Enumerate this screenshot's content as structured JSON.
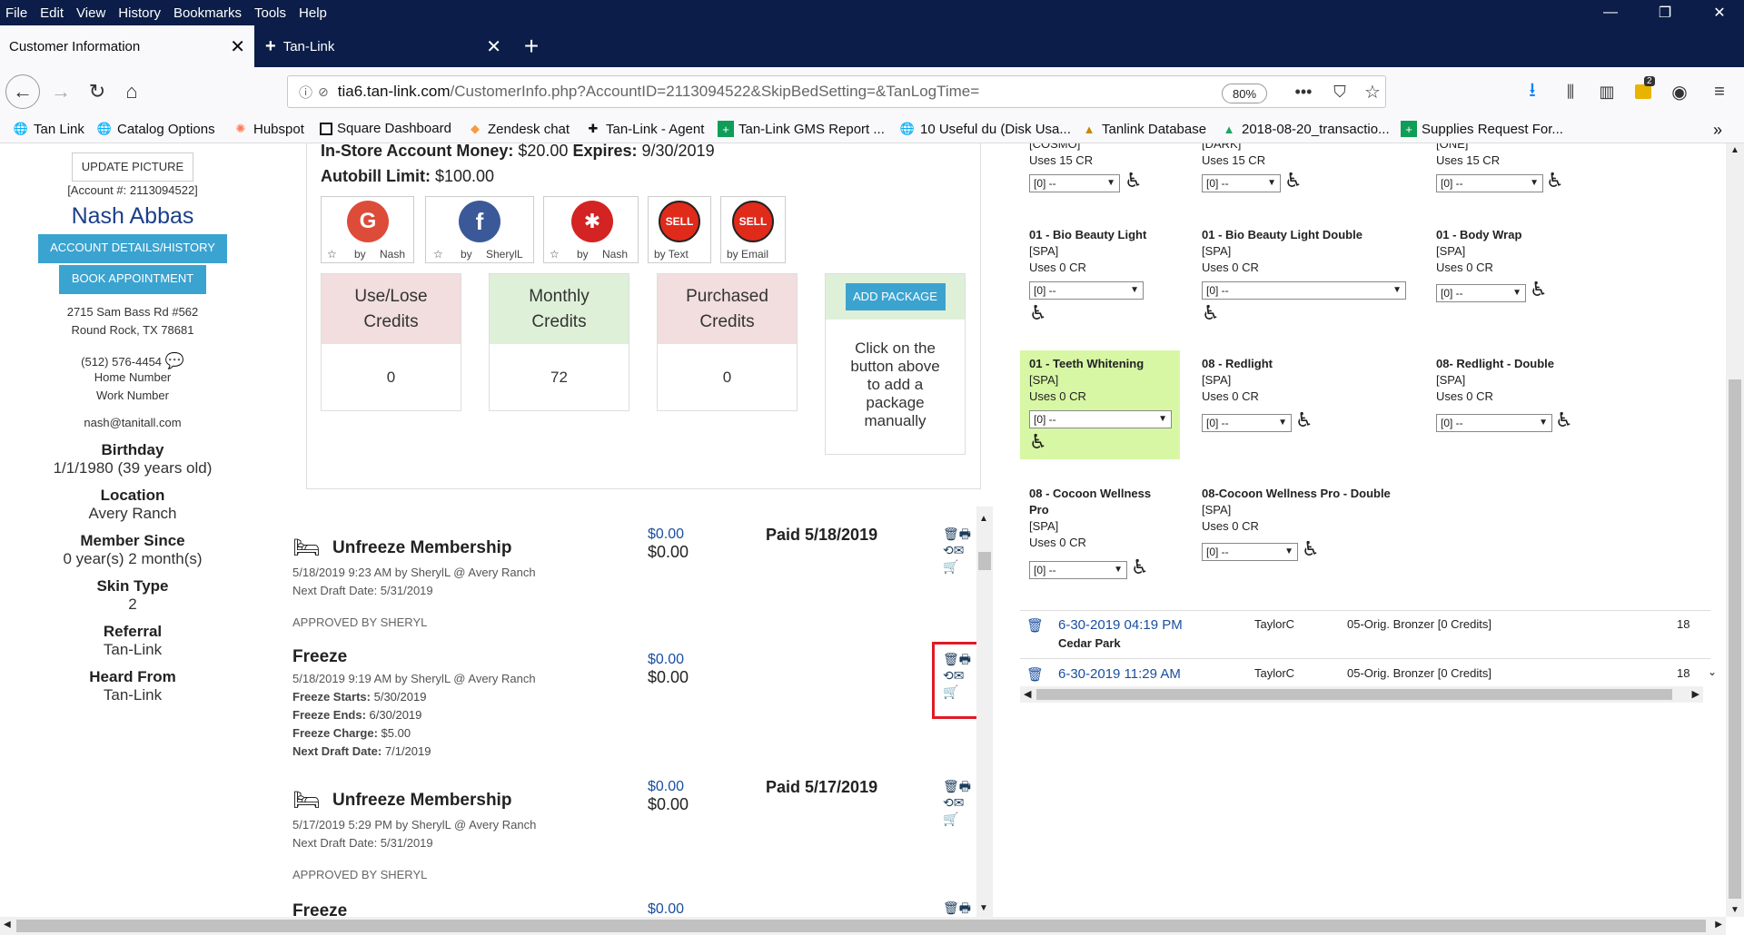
{
  "menu": [
    "File",
    "Edit",
    "View",
    "History",
    "Bookmarks",
    "Tools",
    "Help"
  ],
  "tabs": [
    {
      "label": "Customer Information"
    },
    {
      "label": "Tan-Link"
    }
  ],
  "url": {
    "host": "tia6.tan-link.com",
    "path": "/CustomerInfo.php?AccountID=2113094522&SkipBedSetting=&TanLogTime=",
    "zoom": "80%"
  },
  "toolbar": {
    "ext_badge": "2"
  },
  "bookmarks": [
    "Tan Link",
    "Catalog Options",
    "Hubspot",
    "Square Dashboard",
    "Zendesk chat",
    "Tan-Link - Agent",
    "Tan-Link GMS Report ...",
    "10 Useful du (Disk Usa...",
    "Tanlink Database",
    "2018-08-20_transactio...",
    "Supplies Request For..."
  ],
  "profile": {
    "update_picture": "UPDATE PICTURE",
    "account": "[Account #: 2113094522]",
    "name": "Nash Abbas",
    "details_btn": "ACCOUNT DETAILS/HISTORY",
    "book_btn": "BOOK APPOINTMENT",
    "addr1": "2715 Sam Bass Rd #562",
    "addr2": "Round Rock, TX 78681",
    "phone": "(512) 576-4454",
    "home": "Home Number",
    "work": "Work Number",
    "email": "nash@tanitall.com",
    "birthday_lbl": "Birthday",
    "birthday": "1/1/1980 (39 years old)",
    "location_lbl": "Location",
    "location": "Avery Ranch",
    "member_lbl": "Member Since",
    "member": "0 year(s) 2 month(s)",
    "skin_lbl": "Skin Type",
    "skin": "2",
    "referral_lbl": "Referral",
    "referral": "Tan-Link",
    "heard_lbl": "Heard From",
    "heard": "Tan-Link"
  },
  "account": {
    "money_lbl": "In-Store Account Money:",
    "money": "$20.00",
    "expires_lbl": "Expires:",
    "expires": "9/30/2019",
    "autobill_lbl": "Autobill Limit:",
    "autobill": "$100.00"
  },
  "social": [
    {
      "letter": "G",
      "by": "by",
      "who": "Nash",
      "color": "#dd4b39"
    },
    {
      "letter": "f",
      "by": "by",
      "who": "SherylL",
      "color": "#3b5998"
    },
    {
      "letter": "✱",
      "by": "by",
      "who": "Nash",
      "color": "#d32323"
    },
    {
      "letter": "SELL",
      "cap": "by Text"
    },
    {
      "letter": "SELL",
      "cap": "by Email"
    }
  ],
  "credits": [
    {
      "title1": "Use/Lose",
      "title2": "Credits",
      "value": "0",
      "bg": "#f2dede"
    },
    {
      "title1": "Monthly",
      "title2": "Credits",
      "value": "72",
      "bg": "#dff0d8"
    },
    {
      "title1": "Purchased",
      "title2": "Credits",
      "value": "0",
      "bg": "#f2dede"
    }
  ],
  "package": {
    "btn": "ADD PACKAGE",
    "l1": "Click on the",
    "l2": "button above",
    "l3": "to add a",
    "l4": "package",
    "l5": "manually"
  },
  "transactions": [
    {
      "title": "Unfreeze Membership",
      "line1": "5/18/2019 9:23 AM by SherylL @ Avery Ranch",
      "line2": "Next Draft Date: 5/31/2019",
      "m1": "$0.00",
      "m2": "$0.00",
      "paid": "Paid 5/18/2019",
      "approved": "APPROVED BY SHERYL"
    },
    {
      "title": "Freeze",
      "line1": "5/18/2019 9:19 AM by SherylL @ Avery Ranch",
      "fs_lbl": "Freeze Starts:",
      "fs": "5/30/2019",
      "fe_lbl": "Freeze Ends:",
      "fe": "6/30/2019",
      "fc_lbl": "Freeze Charge:",
      "fc": "$5.00",
      "nd_lbl": "Next Draft Date:",
      "nd": "7/1/2019",
      "m1": "$0.00",
      "m2": "$0.00"
    },
    {
      "title": "Unfreeze Membership",
      "line1": "5/17/2019 5:29 PM by SherylL @ Avery Ranch",
      "line2": "Next Draft Date: 5/31/2019",
      "m1": "$0.00",
      "m2": "$0.00",
      "paid": "Paid 5/17/2019",
      "approved": "APPROVED BY SHERYL"
    },
    {
      "title": "Freeze",
      "m1": "$0.00"
    }
  ],
  "services": [
    {
      "tag": "[COSMO]",
      "uses": "Uses 15 CR",
      "sel": "[0] --"
    },
    {
      "tag": "[DARK]",
      "uses": "Uses 15 CR",
      "sel": "[0] --"
    },
    {
      "tag": "[ONE]",
      "uses": "Uses 15 CR",
      "sel": "[0] --"
    },
    {
      "name": "01 - Bio Beauty Light",
      "tag": "[SPA]",
      "uses": "Uses 0 CR",
      "sel": "[0] --"
    },
    {
      "name": "01 - Bio Beauty Light Double",
      "tag": "[SPA]",
      "uses": "Uses 0 CR",
      "sel": "[0] --"
    },
    {
      "name": "01 - Body Wrap",
      "tag": "[SPA]",
      "uses": "Uses 0 CR",
      "sel": "[0] --"
    },
    {
      "name": "01 - Teeth Whitening",
      "tag": "[SPA]",
      "uses": "Uses 0 CR",
      "sel": "[0] --"
    },
    {
      "name": "08 - Redlight",
      "tag": "[SPA]",
      "uses": "Uses 0 CR",
      "sel": "[0] --"
    },
    {
      "name": "08- Redlight - Double",
      "tag": "[SPA]",
      "uses": "Uses 0 CR",
      "sel": "[0] --"
    },
    {
      "name1": "08 - Cocoon Wellness",
      "name2": "Pro",
      "tag": "[SPA]",
      "uses": "Uses 0 CR",
      "sel": "[0] --"
    },
    {
      "name": "08-Cocoon Wellness Pro - Double",
      "tag": "[SPA]",
      "uses": "Uses 0 CR",
      "sel": "[0] --"
    }
  ],
  "tanlog": [
    {
      "date": "6-30-2019 04:19 PM",
      "loc": "Cedar Park",
      "user": "TaylorC",
      "bed": "05-Orig. Bronzer [0 Credits]",
      "num": "18"
    },
    {
      "date": "6-30-2019 11:29 AM",
      "user": "TaylorC",
      "bed": "05-Orig. Bronzer [0 Credits]",
      "num": "18"
    }
  ]
}
